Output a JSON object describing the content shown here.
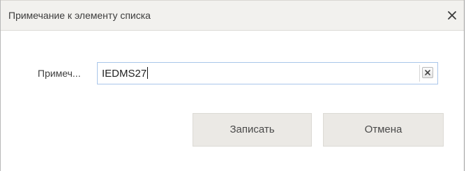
{
  "dialog": {
    "title": "Примечание к элементу списка",
    "close_icon": "close-icon"
  },
  "form": {
    "note_label": "Примеч...",
    "note_value": "IEDMS27",
    "clear_icon": "clear-icon"
  },
  "buttons": {
    "save_label": "Записать",
    "cancel_label": "Отмена"
  },
  "colors": {
    "titlebar_bg": "#f2f1ee",
    "button_bg": "#ebe9e5",
    "field_border": "#a9c6ea"
  }
}
